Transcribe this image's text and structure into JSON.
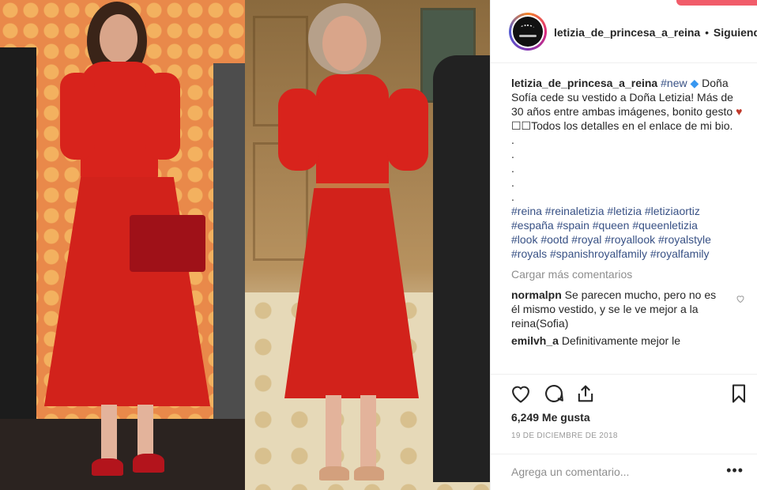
{
  "photo": {
    "description_icons": [
      "queen-letizia-photo",
      "queen-sofia-photo"
    ]
  },
  "header": {
    "username": "letizia_de_princesa_a_reina",
    "separator": "•",
    "follow_status": "Siguiendo"
  },
  "caption": {
    "username": "letizia_de_princesa_a_reina",
    "hashtag_new": "#new",
    "diamond": "◆",
    "text_main": "Doña Sofía cede su vestido a Doña Letizia! Más de 30 años entre ambas imágenes, bonito gesto",
    "heart": "♥",
    "details_line": "☐☐Todos los detalles en el enlace de mi bio.",
    "dots": [
      ".",
      ".",
      ".",
      ".",
      "."
    ],
    "hashtags_1": "#reina #reinaletizia #letizia #letiziaortiz",
    "hashtags_2": "#españa #spain #queen #queenletizia",
    "hashtags_3": "#look #ootd #royal #royallook #royalstyle",
    "hashtags_4": "#royals #spanishroyalfamily #royalfamily"
  },
  "load_more": "Cargar más comentarios",
  "comments": [
    {
      "user": "normalpn",
      "text": "Se parecen mucho, pero no es él mismo vestido, y se le ve mejor a la reina(Sofia)"
    },
    {
      "user": "emilvh_a",
      "text": "Definitivamente mejor le"
    }
  ],
  "likes": "6,249 Me gusta",
  "date": "19 DE DICIEMBRE DE 2018",
  "comment_input": {
    "placeholder": "Agrega un comentario..."
  },
  "more_options": "•••",
  "colors": {
    "link": "#385185",
    "heart": "#c0392b",
    "dress_red": "#d8231c"
  }
}
